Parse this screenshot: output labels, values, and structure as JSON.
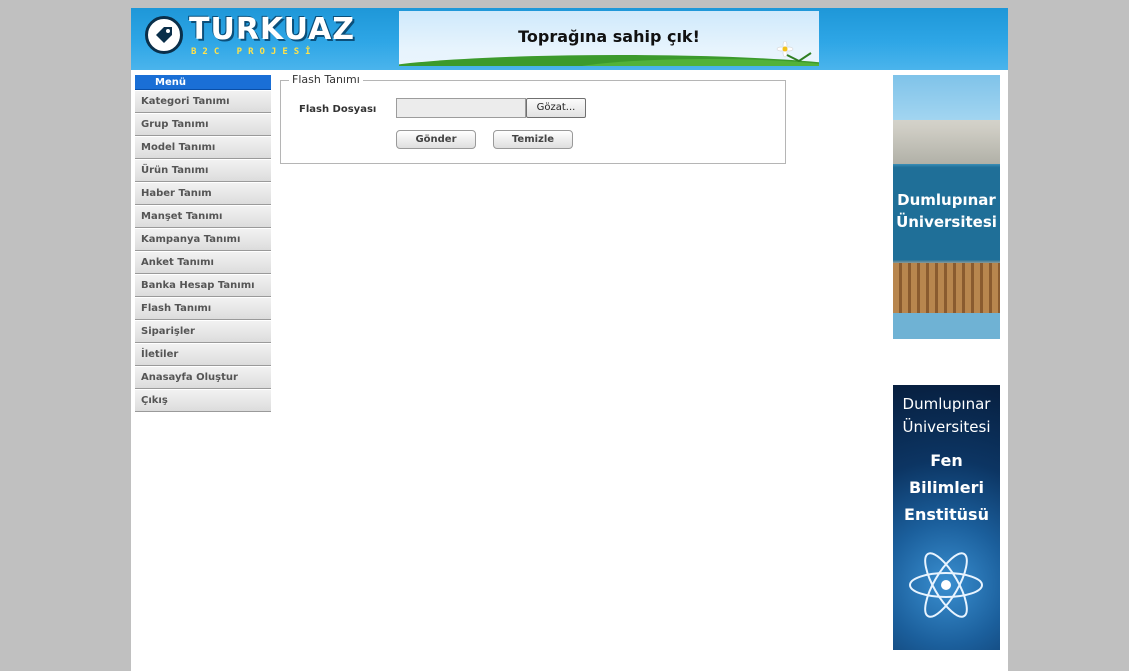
{
  "header": {
    "logo_title": "TURKUAZ",
    "logo_subtitle": "B2C PROJESİ",
    "banner_text": "Toprağına sahip çık!"
  },
  "menu": {
    "title": "Menü",
    "items": [
      {
        "label": "Kategori Tanımı"
      },
      {
        "label": "Grup Tanımı"
      },
      {
        "label": "Model Tanımı"
      },
      {
        "label": "Ürün Tanımı"
      },
      {
        "label": "Haber Tanım"
      },
      {
        "label": "Manşet Tanımı"
      },
      {
        "label": "Kampanya Tanımı"
      },
      {
        "label": "Anket Tanımı"
      },
      {
        "label": "Banka Hesap Tanımı"
      },
      {
        "label": "Flash Tanımı"
      },
      {
        "label": "Siparişler"
      },
      {
        "label": "İletiler"
      },
      {
        "label": "Anasayfa Oluştur"
      },
      {
        "label": "Çıkış"
      }
    ]
  },
  "form": {
    "legend": "Flash Tanımı",
    "file_label": "Flash Dosyası",
    "file_value": "",
    "browse_label": "Gözat...",
    "submit_label": "Gönder",
    "clear_label": "Temizle"
  },
  "ads": {
    "ad1_line1": "Dumlupınar",
    "ad1_line2": "Üniversitesi",
    "ad2_line1": "Dumlupınar",
    "ad2_line2": "Üniversitesi",
    "ad2_line3": "Fen",
    "ad2_line4": "Bilimleri",
    "ad2_line5": "Enstitüsü"
  },
  "colors": {
    "header_blue": "#2ea6e6",
    "menu_header": "#1a6fd6",
    "page_background": "#c0c0c0"
  }
}
